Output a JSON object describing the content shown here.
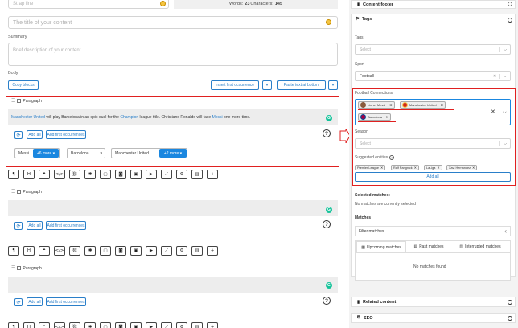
{
  "editor": {
    "strap_placeholder": "Strap line",
    "words_label": "Words:",
    "words_value": "23",
    "characters_label": "Characters:",
    "characters_value": "145",
    "title_placeholder": "The title of your content",
    "summary_label": "Summary",
    "summary_placeholder": "Brief description of your content...",
    "body_label": "Body",
    "copy_blocks": "Copy blocks",
    "insert_first": "Insert first occurrence",
    "paste_bottom": "Paste text at bottom"
  },
  "paragraph_block": {
    "label": "Paragraph",
    "text_parts": [
      {
        "text": "Manchester United",
        "link": true
      },
      {
        "text": " will play Barcelona in an epic duel for the ",
        "link": false
      },
      {
        "text": "Champion",
        "link": true
      },
      {
        "text": " league title. Christiano Ronaldo will face ",
        "link": false
      },
      {
        "text": "Messi",
        "link": true
      },
      {
        "text": " one more time.",
        "link": false
      }
    ],
    "add_all": "Add all",
    "add_first": "Add first occurrences",
    "suggestions": [
      {
        "name": "Messi",
        "more": "+6 more"
      },
      {
        "name": "Barcelona"
      },
      {
        "name": "Manchester United",
        "more": "+2 more"
      }
    ]
  },
  "toolbar": {
    "icons": [
      "paragraph-icon",
      "heading-icon",
      "quote-icon",
      "code-icon",
      "link-icon",
      "asterisk-icon",
      "document-icon",
      "camera-icon",
      "image-icon",
      "video-icon",
      "chart-icon",
      "settings-icon",
      "stats-icon",
      "plus-icon"
    ],
    "glyphs": [
      "¶",
      "H",
      "❝",
      "</>",
      "⛓",
      "✱",
      "▢",
      "◙",
      "▣",
      "▶",
      "⟋",
      "⚙",
      "▥",
      "+"
    ]
  },
  "paragraph_block_2": {
    "label": "Paragraph",
    "add_all": "Add all",
    "add_first": "Add first occurrences"
  },
  "paragraph_block_3": {
    "label": "Paragraph",
    "add_all": "Add all",
    "add_first": "Add first occurrences"
  },
  "sidebar": {
    "content_footer": "Content footer",
    "tags_title": "Tags",
    "tags_label": "Tags",
    "tags_placeholder": "Select",
    "sport_label": "Sport",
    "sport_value": "Football",
    "football_connections_label": "Football Connections",
    "connections": [
      {
        "name": "Lionel Messi",
        "color": "#8a5a3c"
      },
      {
        "name": "Manchester United",
        "color": "#d4261b"
      },
      {
        "name": "Barcelona",
        "color": "#a50044"
      }
    ],
    "season_label": "Season",
    "season_placeholder": "Select",
    "suggested_label": "Suggested entities",
    "suggested": [
      "Premier League",
      "Ralf Rangnick",
      "LaLiga",
      "Xavi Hernandez"
    ],
    "add_all": "Add all",
    "selected_matches_title": "Selected matches:",
    "selected_matches_empty": "No matches are currently selected",
    "matches_title": "Matches",
    "filter_matches": "Filter matches",
    "tabs": [
      "Upcoming matches",
      "Past matches",
      "Interrupted matches"
    ],
    "no_matches": "No matches found",
    "related_content": "Related content",
    "seo": "SEO"
  },
  "colors": {
    "accent": "#1a87e0",
    "link": "#2a7fc9",
    "highlight": "#e02020",
    "grammarly": "#15c39a"
  }
}
